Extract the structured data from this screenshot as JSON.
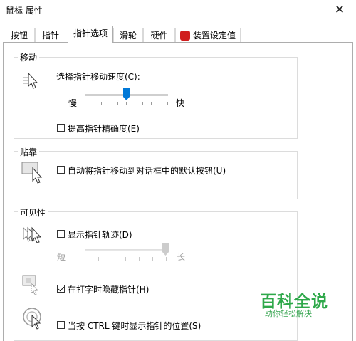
{
  "window": {
    "title": "鼠标 属性",
    "close_glyph": "✕"
  },
  "tabs": [
    {
      "label": "按钮",
      "active": false
    },
    {
      "label": "指针",
      "active": false
    },
    {
      "label": "指针选项",
      "active": true
    },
    {
      "label": "滑轮",
      "active": false
    },
    {
      "label": "硬件",
      "active": false
    },
    {
      "label": "装置设定值",
      "active": false,
      "icon": "settings-app-icon"
    }
  ],
  "motion": {
    "title": "移动",
    "speed_label": "选择指针移动速度(C):",
    "slow_label": "慢",
    "fast_label": "快",
    "speed_value": 0.5,
    "precision_label": "提高指针精确度(E)",
    "precision_checked": false
  },
  "snap": {
    "title": "贴靠",
    "label": "自动将指针移动到对话框中的默认按钮(U)",
    "checked": false
  },
  "visibility": {
    "title": "可见性",
    "trails_label": "显示指针轨迹(D)",
    "trails_checked": false,
    "short_label": "短",
    "long_label": "长",
    "trail_length_value": 1.0,
    "hide_label": "在打字时隐藏指针(H)",
    "hide_checked": true,
    "ctrl_label": "当按 CTRL 键时显示指针的位置(S)",
    "ctrl_checked": false
  },
  "watermark": {
    "title": "百科全说",
    "subtitle": "助你轻松解决"
  },
  "colors": {
    "accent": "#0078d7",
    "watermark": "#2ea84a",
    "settings_icon": "#d01e1e"
  }
}
